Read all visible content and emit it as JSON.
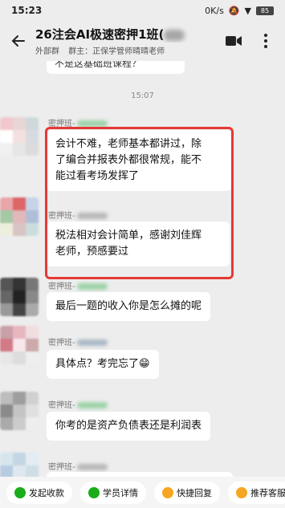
{
  "status_bar": {
    "time": "15:23",
    "net_speed": "0K/s",
    "battery": "85"
  },
  "header": {
    "title": "26注会AI极速密押1班(",
    "subtitle_tag": "外部群",
    "subtitle_members": "群主：正保学管师晴晴老师"
  },
  "chat": {
    "partial_prev_message": "不是这基础班课程？",
    "time_divider": "15:07",
    "messages": [
      {
        "sender": "密押班-",
        "text_lines": [
          "会计不难，老师基本都讲过，除",
          "了编合并报表外都很常规，能不",
          "能过看考场发挥了"
        ]
      },
      {
        "sender": "密押班-",
        "text_lines": [
          "税法相对会计简单，感谢刘佳辉",
          "老师，预感要过"
        ]
      },
      {
        "sender": "密押班-",
        "text_lines": [
          "最后一题的收入你是怎么摊的呢"
        ]
      },
      {
        "sender": "密押班-",
        "text_lines": [
          "具体点？考完忘了😁"
        ]
      },
      {
        "sender": "密押班-",
        "text_lines": [
          "你考的是资产负债表还是利润表"
        ]
      },
      {
        "sender": "密押班-",
        "text_lines": []
      }
    ]
  },
  "bottom_actions": [
    {
      "label": "发起收款",
      "icon": "yen-icon",
      "color": "#1aad19"
    },
    {
      "label": "学员详情",
      "icon": "user-icon",
      "color": "#1aad19"
    },
    {
      "label": "快捷回复",
      "icon": "chat-icon",
      "color": "#f5a623"
    },
    {
      "label": "推荐客服",
      "icon": "service-icon",
      "color": "#f5a623"
    }
  ]
}
